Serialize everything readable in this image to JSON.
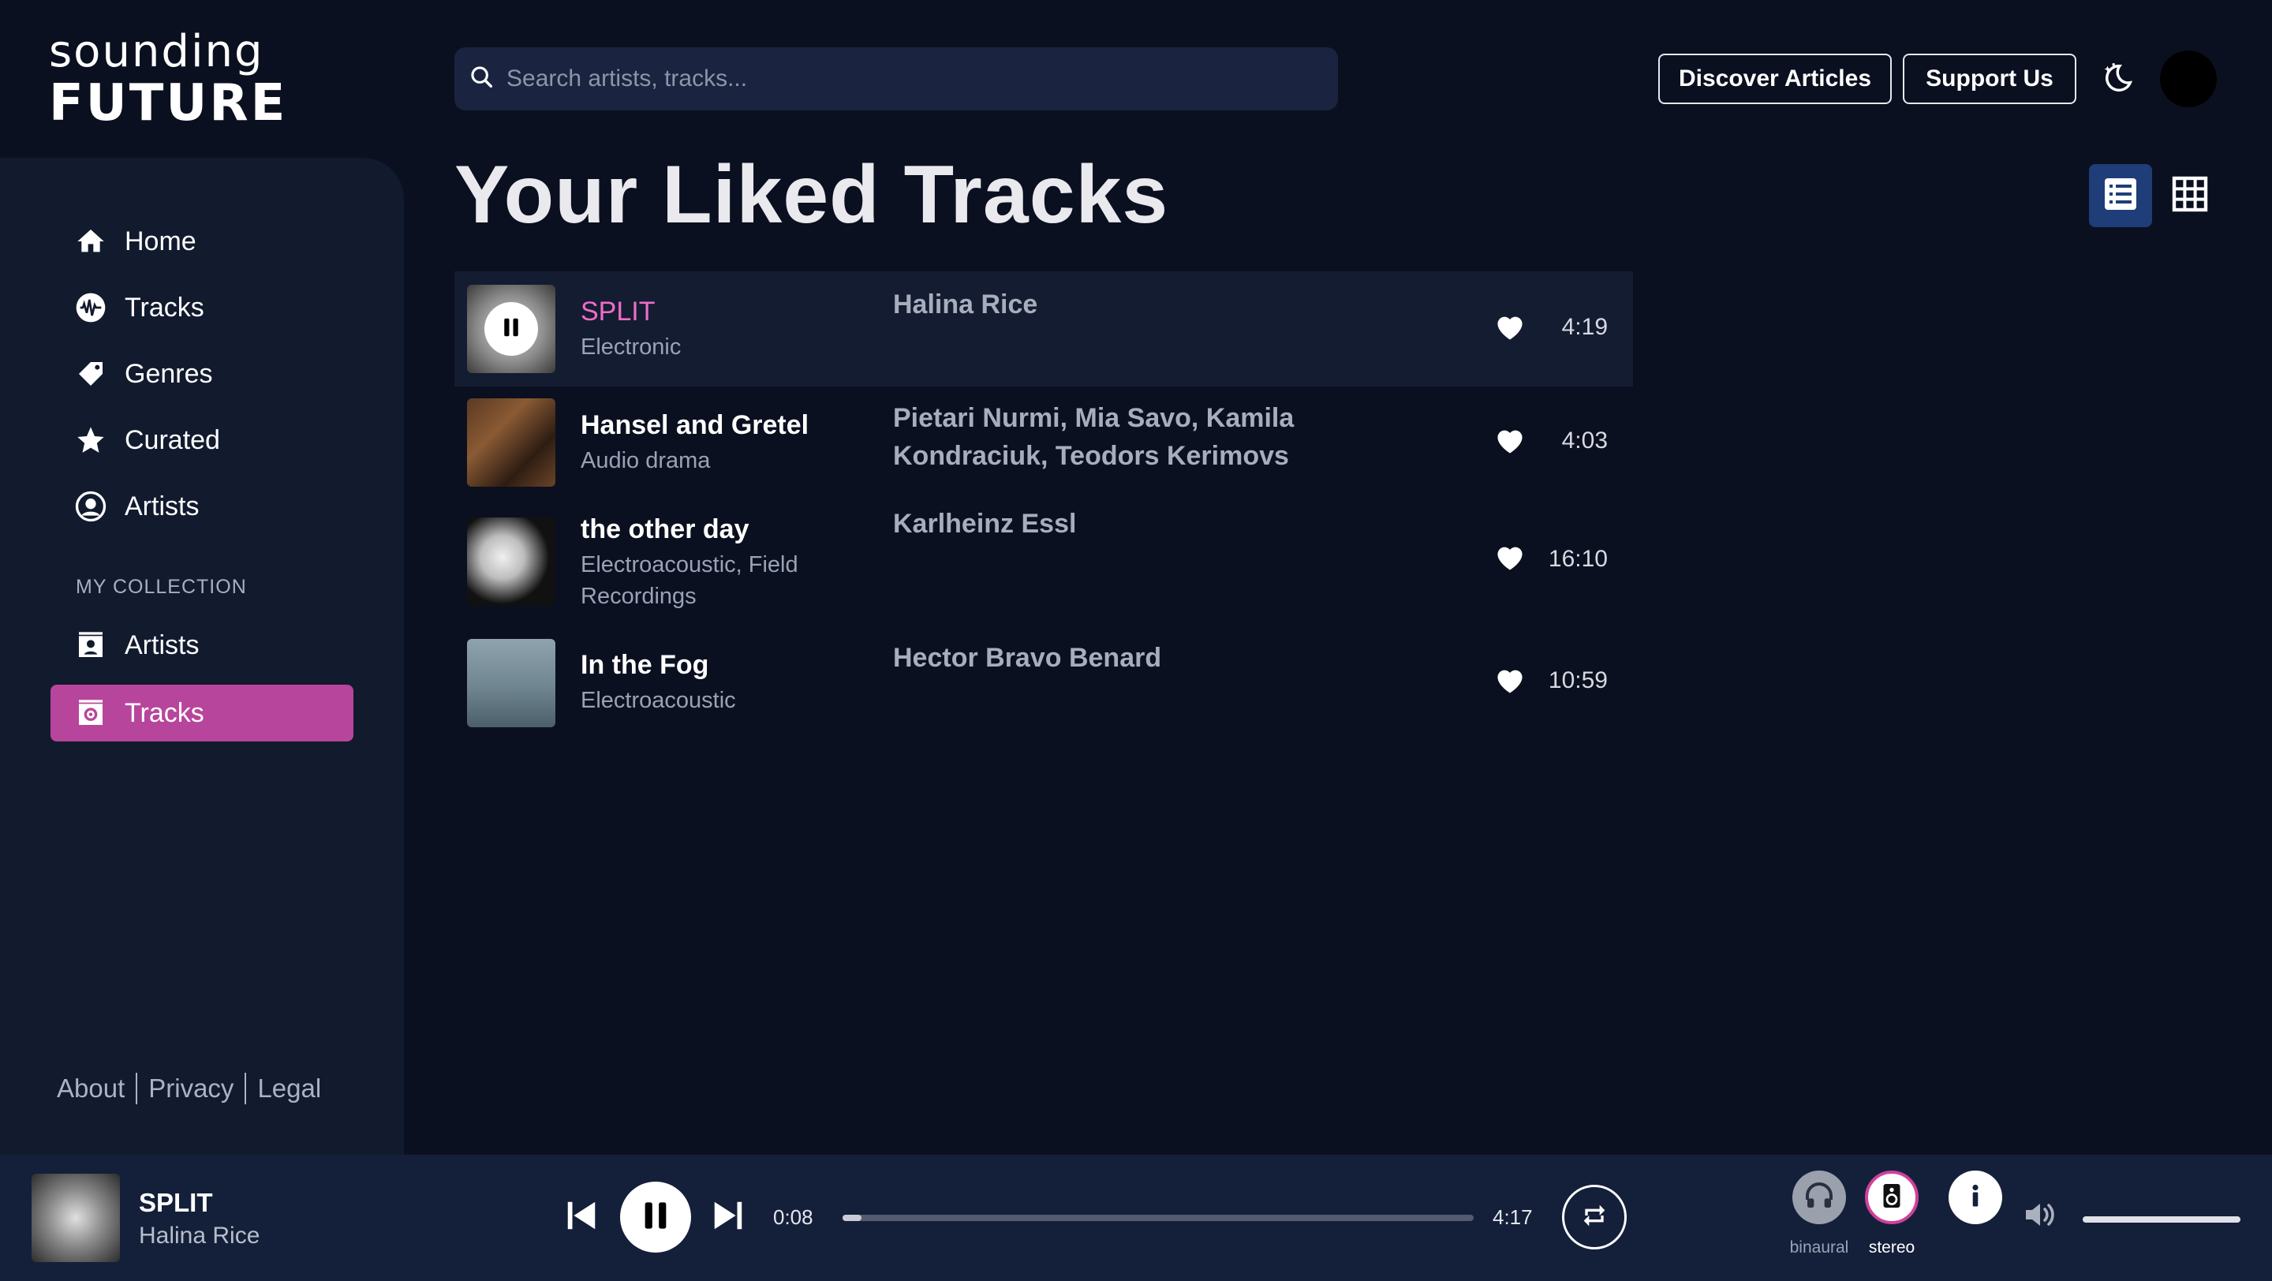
{
  "app": {
    "logo_top": "sounding",
    "logo_bottom": "FUTURE"
  },
  "sidebar": {
    "items": [
      {
        "label": "Home",
        "icon": "home-icon"
      },
      {
        "label": "Tracks",
        "icon": "waveform-icon"
      },
      {
        "label": "Genres",
        "icon": "tag-icon"
      },
      {
        "label": "Curated",
        "icon": "star-icon"
      },
      {
        "label": "Artists",
        "icon": "user-circle-icon"
      }
    ],
    "section_label": "MY COLLECTION",
    "collection_items": [
      {
        "label": "Artists",
        "icon": "contact-card-icon",
        "active": false
      },
      {
        "label": "Tracks",
        "icon": "music-folder-icon",
        "active": true
      }
    ],
    "footer": {
      "about": "About",
      "privacy": "Privacy",
      "legal": "Legal"
    }
  },
  "header": {
    "search_placeholder": "Search artists, tracks...",
    "discover_label": "Discover Articles",
    "support_label": "Support Us"
  },
  "main": {
    "title": "Your Liked Tracks",
    "tracks": [
      {
        "title": "SPLIT",
        "genre": "Electronic",
        "artist": "Halina Rice",
        "duration": "4:19",
        "playing": true
      },
      {
        "title": "Hansel and Gretel",
        "genre": "Audio drama",
        "artist": "Pietari Nurmi, Mia Savo, Kamila Kondraciuk, Teodors Kerimovs",
        "duration": "4:03",
        "playing": false
      },
      {
        "title": "the other day",
        "genre": "Electroacoustic, Field Recordings",
        "artist": "Karlheinz Essl",
        "duration": "16:10",
        "playing": false
      },
      {
        "title": "In the Fog",
        "genre": "Electroacoustic",
        "artist": "Hector Bravo Benard",
        "duration": "10:59",
        "playing": false
      }
    ]
  },
  "player": {
    "title": "SPLIT",
    "artist": "Halina Rice",
    "current_time": "0:08",
    "total_time": "4:17",
    "progress": 0.03,
    "binaural_label": "binaural",
    "stereo_label": "stereo",
    "volume": 1.0
  },
  "colors": {
    "accent": "#b8459c",
    "playing_title": "#f06cc8",
    "background": "#0b1020",
    "sidebar": "#121a2e",
    "player": "#14203a"
  }
}
